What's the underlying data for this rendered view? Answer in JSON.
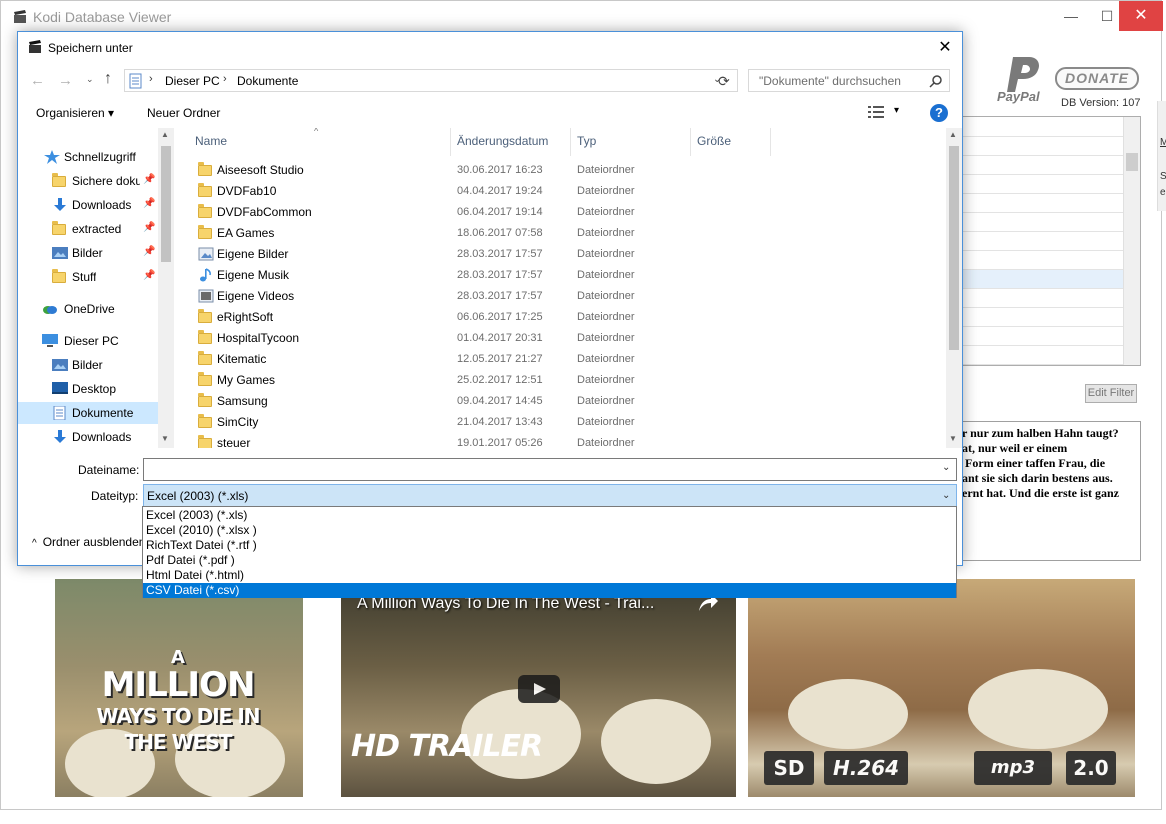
{
  "main_window": {
    "title": "Kodi Database Viewer",
    "controls": {
      "minimize": "—",
      "maximize": "☐",
      "close": "✕"
    },
    "donate_label": "DONATE",
    "paypal_text": "PayPal",
    "db_version": "DB Version: 107",
    "edit_filter_label": "Edit Filter",
    "plot_lines": [
      "r nur zum halben Hahn taugt?",
      "at, nur weil er einem",
      " Form einer taffen Frau, die",
      "ant sie sich darin bestens aus.",
      "ernt hat. Und die erste ist ganz"
    ],
    "right_edge_texts": [
      "M",
      "Sr",
      "e"
    ],
    "posters": {
      "left_title": [
        "A",
        "MILLION",
        "WAYS TO DIE IN THE WEST"
      ],
      "video_title": "A Million Ways To Die In The West - Trai...",
      "video_brand": "HD TRAILER",
      "badges": [
        "SD",
        "H.264",
        "mp3",
        "2.0"
      ]
    }
  },
  "dialog": {
    "title": "Speichern unter",
    "close": "✕",
    "nav": {
      "back": "←",
      "forward": "→",
      "recent": "⌄",
      "up": "↑",
      "refresh": "⟳",
      "dropdown": "⌄"
    },
    "breadcrumb": [
      "Dieser PC",
      "Dokumente"
    ],
    "breadcrumb_sep": "›",
    "search_placeholder": "\"Dokumente\" durchsuchen",
    "toolbar": {
      "organize": "Organisieren ▾",
      "new_folder": "Neuer Ordner",
      "view_dropdown": "▾",
      "help": "?"
    },
    "nav_tree": [
      {
        "label": "Schnellzugriff",
        "icon": "star-icon",
        "pinned": false
      },
      {
        "label": "Sichere dokumente",
        "icon": "folder-icon",
        "pinned": true
      },
      {
        "label": "Downloads",
        "icon": "download-icon",
        "pinned": true
      },
      {
        "label": "extracted",
        "icon": "folder-icon",
        "pinned": true
      },
      {
        "label": "Bilder",
        "icon": "pictures-icon",
        "pinned": true
      },
      {
        "label": "Stuff",
        "icon": "folder-icon",
        "pinned": true
      },
      {
        "label": "OneDrive",
        "icon": "cloud-icon",
        "pinned": false
      },
      {
        "label": "Dieser PC",
        "icon": "computer-icon",
        "pinned": false
      },
      {
        "label": "Bilder",
        "icon": "pictures-icon",
        "pinned": false
      },
      {
        "label": "Desktop",
        "icon": "desktop-icon",
        "pinned": false
      },
      {
        "label": "Dokumente",
        "icon": "documents-icon",
        "pinned": false
      },
      {
        "label": "Downloads",
        "icon": "download-icon",
        "pinned": false
      }
    ],
    "pin_glyph": "📌",
    "columns": [
      "Name",
      "Änderungsdatum",
      "Typ",
      "Größe"
    ],
    "files": [
      {
        "name": "Aiseesoft Studio",
        "date": "30.06.2017 16:23",
        "type": "Dateiordner",
        "icon": "folder-icon"
      },
      {
        "name": "DVDFab10",
        "date": "04.04.2017 19:24",
        "type": "Dateiordner",
        "icon": "folder-icon"
      },
      {
        "name": "DVDFabCommon",
        "date": "06.04.2017 19:14",
        "type": "Dateiordner",
        "icon": "folder-icon"
      },
      {
        "name": "EA Games",
        "date": "18.06.2017 07:58",
        "type": "Dateiordner",
        "icon": "folder-icon"
      },
      {
        "name": "Eigene Bilder",
        "date": "28.03.2017 17:57",
        "type": "Dateiordner",
        "icon": "pictures-folder-icon"
      },
      {
        "name": "Eigene Musik",
        "date": "28.03.2017 17:57",
        "type": "Dateiordner",
        "icon": "music-folder-icon"
      },
      {
        "name": "Eigene Videos",
        "date": "28.03.2017 17:57",
        "type": "Dateiordner",
        "icon": "videos-folder-icon"
      },
      {
        "name": "eRightSoft",
        "date": "06.06.2017 17:25",
        "type": "Dateiordner",
        "icon": "folder-icon"
      },
      {
        "name": "HospitalTycoon",
        "date": "01.04.2017 20:31",
        "type": "Dateiordner",
        "icon": "folder-icon"
      },
      {
        "name": "Kitematic",
        "date": "12.05.2017 21:27",
        "type": "Dateiordner",
        "icon": "folder-icon"
      },
      {
        "name": "My Games",
        "date": "25.02.2017 12:51",
        "type": "Dateiordner",
        "icon": "folder-icon"
      },
      {
        "name": "Samsung",
        "date": "09.04.2017 14:45",
        "type": "Dateiordner",
        "icon": "folder-icon"
      },
      {
        "name": "SimCity",
        "date": "21.04.2017 13:43",
        "type": "Dateiordner",
        "icon": "folder-icon"
      },
      {
        "name": "steuer",
        "date": "19.01.2017 05:26",
        "type": "Dateiordner",
        "icon": "folder-icon"
      }
    ],
    "filename_label": "Dateiname:",
    "filename_value": "",
    "filetype_label": "Dateityp:",
    "filetype_value": "Excel (2003) (*.xls)",
    "filetype_options": [
      "Excel (2003) (*.xls)",
      "Excel (2010) (*.xlsx )",
      "RichText Datei (*.rtf )",
      "Pdf Datei (*.pdf )",
      "Html Datei (*.html)",
      "CSV Datei (*.csv)"
    ],
    "filetype_highlighted_index": 5,
    "hide_folders_label": "Ordner ausblenden",
    "hide_folders_glyph": "^"
  },
  "colors": {
    "selection_blue": "#0078d7",
    "nav_selected": "#cce8ff",
    "close_red": "#e04343",
    "folder_yellow": "#f7d46b"
  }
}
